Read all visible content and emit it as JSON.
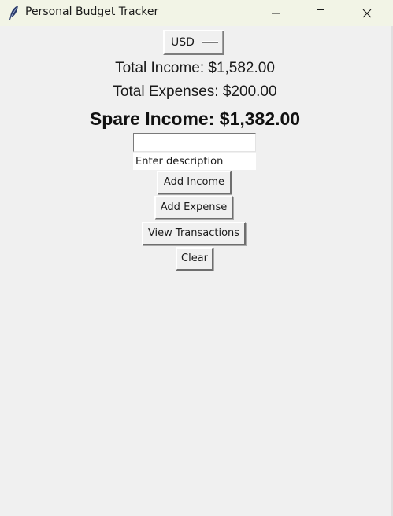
{
  "window": {
    "title": "Personal Budget Tracker"
  },
  "currency": {
    "selected": "USD"
  },
  "summary": {
    "total_income": "Total Income: $1,582.00",
    "total_expenses": "Total Expenses: $200.00",
    "spare_income": "Spare Income: $1,382.00"
  },
  "form": {
    "amount_value": "",
    "description_value": "Enter description"
  },
  "buttons": {
    "add_income": "Add Income",
    "add_expense": "Add Expense",
    "view_transactions": "View Transactions",
    "clear": "Clear"
  },
  "icons": {
    "app": "feather-icon",
    "minimize": "minimize-icon",
    "maximize": "maximize-icon",
    "close": "close-icon"
  },
  "colors": {
    "window_bg": "#f0f0f0",
    "titlebar_bg": "#f2f4e6",
    "text": "#1a1a1a"
  }
}
